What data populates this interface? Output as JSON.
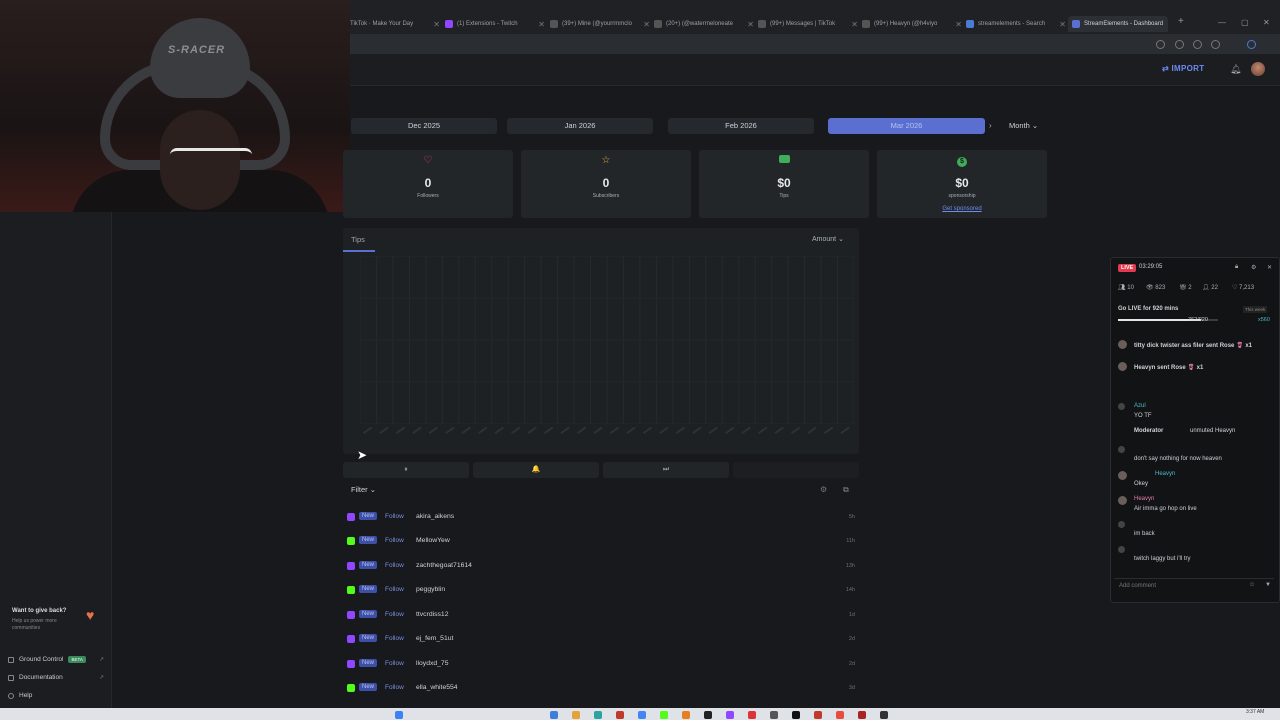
{
  "browser": {
    "tabs": [
      {
        "label": "TikTok · Make Your Day"
      },
      {
        "label": "(1) Extensions - Twitch"
      },
      {
        "label": "(39+) Mine (@yourrmmclo"
      },
      {
        "label": "(20+) (@waterrneloneate"
      },
      {
        "label": "(99+) Messages | TikTok"
      },
      {
        "label": "(99+) Heavyn (@h4viyo"
      },
      {
        "label": "streamelements - Search"
      },
      {
        "label": "StreamElements - Dashboard"
      }
    ],
    "new_tab": "+",
    "window_controls": {
      "minimize": "—",
      "maximize": "▢",
      "close": "✕"
    }
  },
  "header": {
    "import_label": "IMPORT"
  },
  "webcam": {
    "headset_brand": "S-RACER"
  },
  "months": {
    "items": [
      "Dec 2025",
      "Jan 2026",
      "Feb 2026",
      "Mar 2026"
    ],
    "selected": "Mar 2026",
    "next": "›",
    "period": "Month ⌄"
  },
  "stats": {
    "followers": {
      "value": "0",
      "label": "Followers",
      "icon": "heart-icon",
      "color": "#e8475c"
    },
    "subscribers": {
      "value": "0",
      "label": "Subscribers",
      "icon": "star-icon",
      "color": "#e2b23a"
    },
    "tips": {
      "value": "$0",
      "label": "Tips",
      "icon": "cash-icon",
      "color": "#3fae5a"
    },
    "sponsorship": {
      "value": "$0",
      "label": "sponsorship",
      "icon": "dollar-icon",
      "color": "#3fae5a",
      "link": "Get sponsored"
    }
  },
  "chart": {
    "tab": "Tips",
    "metric": "Amount ⌄"
  },
  "controls": {
    "pause": "⏸",
    "bell": "🔔",
    "skip": "⏭",
    "filter": "Filter ⌄",
    "settings": "⚙",
    "popout": "⧉"
  },
  "feed": [
    {
      "platform": "twitch",
      "badge": "New",
      "type": "Follow",
      "name": "akira_aikens",
      "time": "5h"
    },
    {
      "platform": "kick",
      "badge": "New",
      "type": "Follow",
      "name": "MellowYew",
      "time": "11h"
    },
    {
      "platform": "twitch",
      "badge": "New",
      "type": "Follow",
      "name": "zachthegoat71614",
      "time": "13h"
    },
    {
      "platform": "kick",
      "badge": "New",
      "type": "Follow",
      "name": "peggyblin",
      "time": "14h"
    },
    {
      "platform": "twitch",
      "badge": "New",
      "type": "Follow",
      "name": "ttvcrdiss12",
      "time": "1d"
    },
    {
      "platform": "twitch",
      "badge": "New",
      "type": "Follow",
      "name": "ej_fem_51ut",
      "time": "2d"
    },
    {
      "platform": "twitch",
      "badge": "New",
      "type": "Follow",
      "name": "lloydxd_75",
      "time": "2d"
    },
    {
      "platform": "kick",
      "badge": "New",
      "type": "Follow",
      "name": "ella_white554",
      "time": "3d"
    }
  ],
  "sidebar": {
    "giveback_title": "Want to give back?",
    "giveback_sub": "Help us power more communities",
    "links": [
      {
        "label": "Ground Control",
        "badge": "BETA"
      },
      {
        "label": "Documentation"
      },
      {
        "label": "Help"
      }
    ]
  },
  "chat": {
    "live": "LIVE",
    "timer": "03:29:05",
    "stats": [
      "10",
      "823",
      "2",
      "22",
      "7,213"
    ],
    "goal": {
      "title": "Go LIVE for 920 mins",
      "week": "This week",
      "progress": "762/920",
      "fraction": 0.828,
      "reward": "x560"
    },
    "gifts": [
      {
        "text": "titty dick twister ass filer sent Rose",
        "count": "x1"
      },
      {
        "text": "Heavyn sent Rose",
        "count": "x1"
      }
    ],
    "messages": [
      {
        "user": "Azul",
        "text": "YO TF"
      },
      {
        "user": "Moderator",
        "text": "unmuted Heavyn"
      },
      {
        "user": "",
        "text": "don't say nothing for now heaven"
      },
      {
        "user": "Heavyn",
        "text": "Okey"
      },
      {
        "user": "Heavyn",
        "text": "Air imma go hop on live"
      },
      {
        "user": "",
        "text": "im back"
      },
      {
        "user": "",
        "text": "twitch laggy but i'll try"
      }
    ],
    "input_placeholder": "Add comment"
  },
  "taskbar": {
    "clock": "3:37 AM"
  }
}
